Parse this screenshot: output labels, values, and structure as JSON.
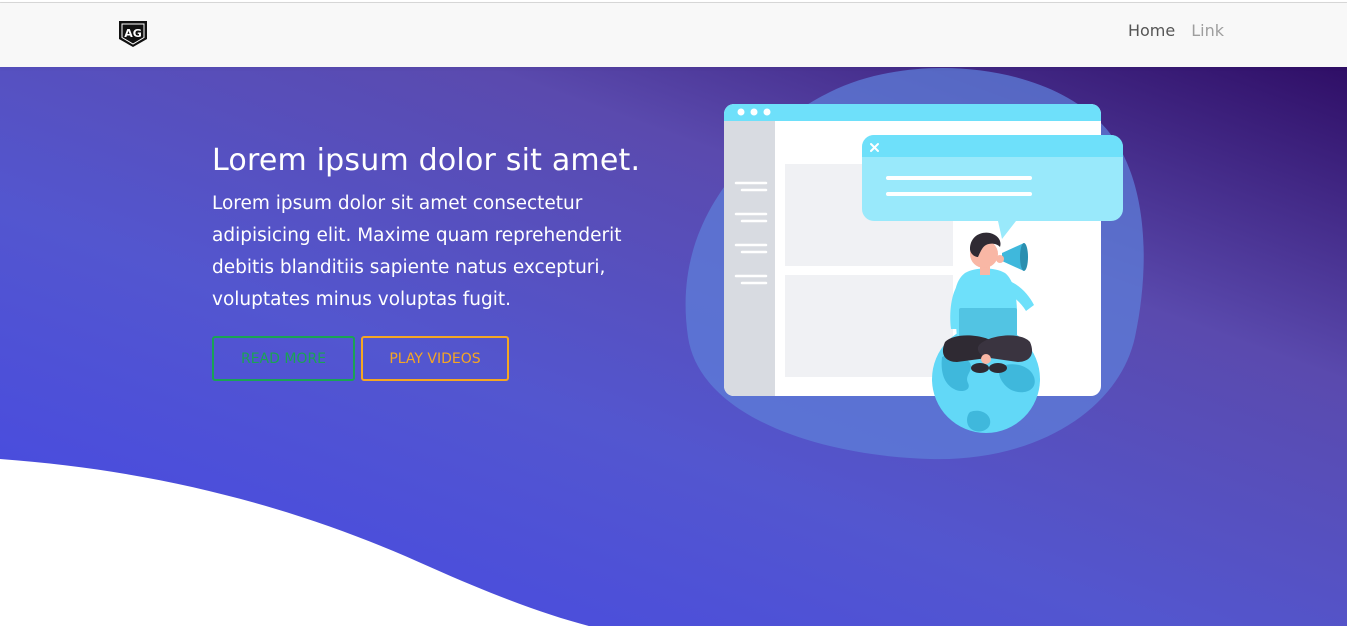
{
  "navbar": {
    "logo_text": "AG",
    "links": [
      {
        "label": "Home"
      },
      {
        "label": "Link"
      }
    ]
  },
  "hero": {
    "title": "Lorem ipsum dolor sit amet.",
    "description": "Lorem ipsum dolor sit amet consectetur adipisicing elit. Maxime quam reprehenderit debitis blanditiis sapiente natus excepturi, voluptates minus voluptas fugit.",
    "buttons": {
      "read_more": "READ MORE",
      "play_videos": "PLAY VIDEOS"
    }
  },
  "colors": {
    "read_more_border": "#1aa354",
    "play_videos_border": "#f5a623",
    "hero_gradient_dark": "#2f0e66",
    "hero_gradient_blue": "#4447e6"
  },
  "icons": {
    "logo": "ag-shield-logo",
    "illustration": "person-with-megaphone-on-globe"
  }
}
